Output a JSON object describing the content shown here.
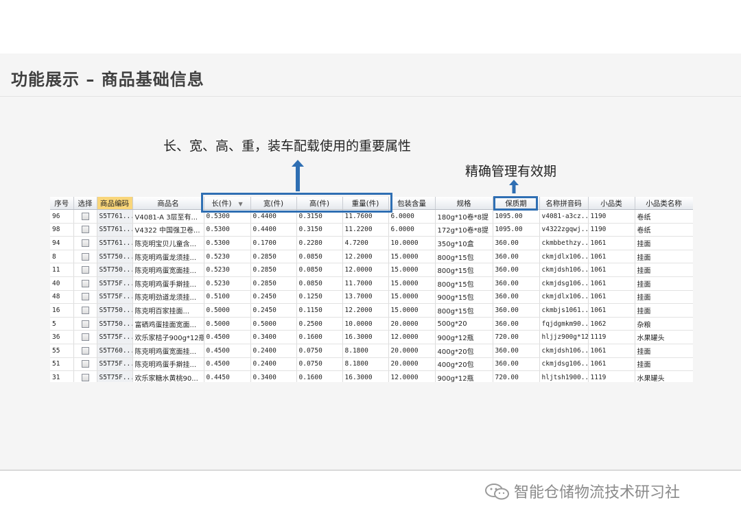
{
  "page": {
    "title": "功能展示 – 商品基础信息",
    "annotation_dims": "长、宽、高、重，装车配载使用的重要属性",
    "annotation_shelf": "精确管理有效期",
    "footer_text": "智能仓储物流技术研习社",
    "accent_color": "#2f6fb3",
    "highlight_color": "#f9d67a"
  },
  "grid": {
    "columns": [
      "序号",
      "选择",
      "商品编码",
      "商品名",
      "长(件)",
      "宽(件)",
      "高(件)",
      "重量(件)",
      "包装含量",
      "规格",
      "保质期",
      "名称拼音码",
      "小品类",
      "小品类名称"
    ],
    "rows": [
      [
        "96",
        "",
        "S5T761...",
        "V4081-A 3层至有...",
        "0.5300",
        "0.4400",
        "0.3150",
        "11.7600",
        "6.0000",
        "180g*10卷*8提",
        "1095.00",
        "v4081-a3cz...",
        "1190",
        "卷纸"
      ],
      [
        "98",
        "",
        "S5T761...",
        "V4322 中国强卫卷...",
        "0.5300",
        "0.4400",
        "0.3150",
        "11.2200",
        "6.0000",
        "172g*10卷*8提",
        "1095.00",
        "v4322zgqwj...",
        "1190",
        "卷纸"
      ],
      [
        "94",
        "",
        "S5T761...",
        "陈克明宝贝儿童含...",
        "0.5300",
        "0.1700",
        "0.2280",
        "4.7200",
        "10.0000",
        "350g*10盒",
        "360.00",
        "ckmbbethzy...",
        "1061",
        "挂面"
      ],
      [
        "8",
        "",
        "S5T750...",
        "陈克明鸡蛋龙须挂...",
        "0.5230",
        "0.2850",
        "0.0850",
        "12.2000",
        "15.0000",
        "800g*15包",
        "360.00",
        "ckmjdlx106...",
        "1061",
        "挂面"
      ],
      [
        "11",
        "",
        "S5T750...",
        "陈克明鸡蛋宽面挂...",
        "0.5230",
        "0.2850",
        "0.0850",
        "12.0000",
        "15.0000",
        "800g*15包",
        "360.00",
        "ckmjdsh106...",
        "1061",
        "挂面"
      ],
      [
        "40",
        "",
        "S5T75F...",
        "陈克明鸡蛋手擀挂...",
        "0.5230",
        "0.2850",
        "0.0850",
        "11.7000",
        "15.0000",
        "800g*15包",
        "360.00",
        "ckmjdsg106...",
        "1061",
        "挂面"
      ],
      [
        "48",
        "",
        "S5T75F...",
        "陈克明劲道龙须挂...",
        "0.5100",
        "0.2450",
        "0.1250",
        "13.7000",
        "15.0000",
        "900g*15包",
        "360.00",
        "ckmjdlx106...",
        "1061",
        "挂面"
      ],
      [
        "16",
        "",
        "S5T750...",
        "陈克明百家挂面...",
        "0.5000",
        "0.2450",
        "0.1150",
        "12.2000",
        "15.0000",
        "800g*15包",
        "360.00",
        "ckmbjs1061...",
        "1061",
        "挂面"
      ],
      [
        "5",
        "",
        "S5T750...",
        "富硒鸡蛋挂面宽面...",
        "0.5000",
        "0.5000",
        "0.2500",
        "10.0000",
        "20.0000",
        "500g*20",
        "360.00",
        "fqjdgmkm90...",
        "1062",
        "杂粮"
      ],
      [
        "36",
        "",
        "S5T75F...",
        "欢乐家桔子900g*12瓶",
        "0.4500",
        "0.3400",
        "0.1600",
        "16.3000",
        "12.0000",
        "900g*12瓶",
        "720.00",
        "hljjz900g*12p",
        "1119",
        "水果罐头"
      ],
      [
        "55",
        "",
        "S5T760...",
        "陈克明鸡蛋宽面挂...",
        "0.4500",
        "0.2400",
        "0.0750",
        "8.1800",
        "20.0000",
        "400g*20包",
        "360.00",
        "ckmjdsh106...",
        "1061",
        "挂面"
      ],
      [
        "51",
        "",
        "S5T75F...",
        "陈克明鸡蛋手擀挂...",
        "0.4500",
        "0.2400",
        "0.0750",
        "8.1800",
        "20.0000",
        "400g*20包",
        "360.00",
        "ckmjdsg106...",
        "1061",
        "挂面"
      ],
      [
        "31",
        "",
        "S5T75F...",
        "欢乐家糖水黄桃90...",
        "0.4450",
        "0.3400",
        "0.1600",
        "16.3000",
        "12.0000",
        "900g*12瓶",
        "720.00",
        "hljtsh1900...",
        "1119",
        "水果罐头"
      ]
    ]
  }
}
